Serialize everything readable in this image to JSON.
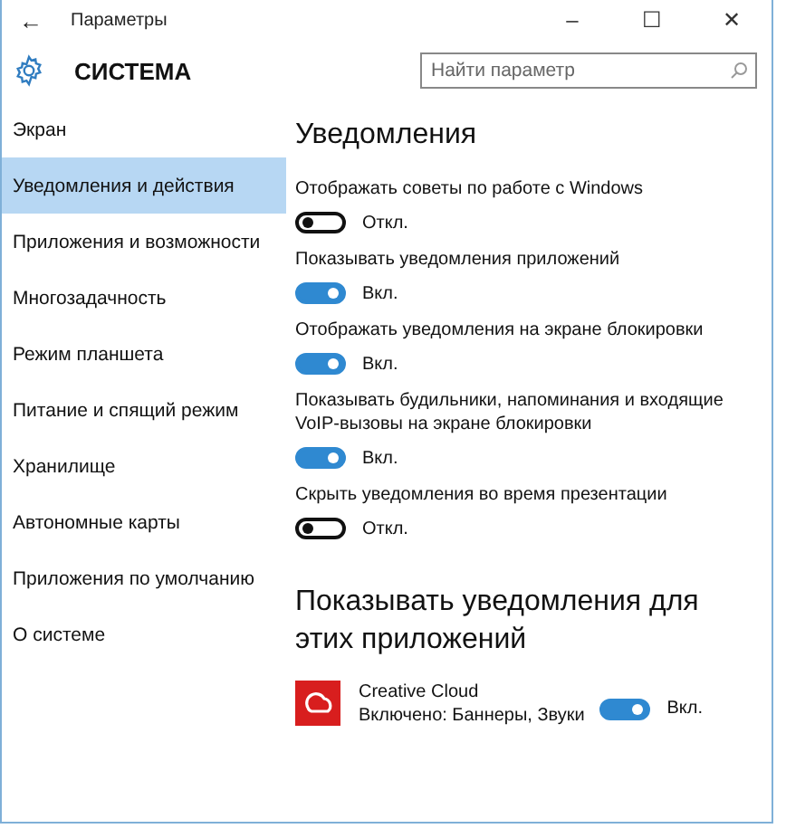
{
  "window": {
    "title": "Параметры",
    "back": "←",
    "controls": [
      "–",
      "☐",
      "✕"
    ]
  },
  "header": {
    "title": "СИСТЕМА",
    "search": {
      "placeholder": "Найти параметр"
    }
  },
  "sidebar": {
    "items": [
      {
        "label": "Экран",
        "selected": false
      },
      {
        "label": "Уведомления и действия",
        "selected": true
      },
      {
        "label": "Приложения и возможности",
        "selected": false
      },
      {
        "label": "Многозадачность",
        "selected": false
      },
      {
        "label": "Режим планшета",
        "selected": false
      },
      {
        "label": "Питание и спящий режим",
        "selected": false
      },
      {
        "label": "Хранилище",
        "selected": false
      },
      {
        "label": "Автономные карты",
        "selected": false
      },
      {
        "label": "Приложения по умолчанию",
        "selected": false
      },
      {
        "label": "О системе",
        "selected": false
      }
    ]
  },
  "content": {
    "title": "Уведомления",
    "settings": [
      {
        "label": "Отображать советы по работе с Windows",
        "on": false,
        "state_text": "Откл."
      },
      {
        "label": "Показывать уведомления приложений",
        "on": true,
        "state_text": "Вкл."
      },
      {
        "label": "Отображать уведомления на экране блокировки",
        "on": true,
        "state_text": "Вкл."
      },
      {
        "label": "Показывать будильники, напоминания и входящие VoIP-вызовы на экране блокировки",
        "on": true,
        "state_text": "Вкл."
      },
      {
        "label": "Скрыть уведомления во время презентации",
        "on": false,
        "state_text": "Откл."
      }
    ],
    "apps_title": "Показывать уведомления для этих приложений",
    "apps": [
      {
        "name": "Creative Cloud",
        "detail": "Включено: Баннеры, Звуки",
        "on": true,
        "state_text": "Вкл."
      }
    ]
  }
}
